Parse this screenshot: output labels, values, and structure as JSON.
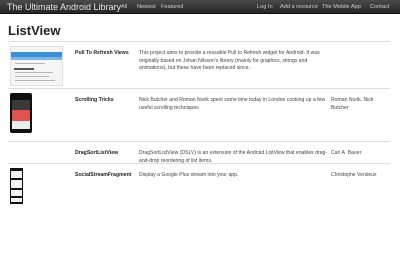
{
  "navbar": {
    "brand": "The Ultimate Android Library",
    "left_links": [
      "All",
      "Newest",
      "Featured"
    ],
    "right_links": [
      "Log In",
      "Add a resource",
      "The Mobile App",
      "Contact"
    ]
  },
  "page": {
    "title": "ListView"
  },
  "rows": [
    {
      "name": "Pull To Refresh Views",
      "description": "This project aims to provide a reusable Pull to Refresh widget for Android. It was originally based on Johan Nilsson's library (mainly for graphics, strings and animations), but these have been replaced since.",
      "author": "",
      "thumbnail": "tablet-screenshot"
    },
    {
      "name": "Scrolling Tricks",
      "description": "Nick Butcher and Roman Nurik spent some time today in London cooking up a few useful scrolling techniques",
      "author": "Roman Nurik, Nick Butcher",
      "thumbnail": "phone-screenshot"
    },
    {
      "name": "DragSortListView",
      "description": "DragSortListView (DSLV) is an extension of the Android ListView that enables drag-and-drop reordering of list items.",
      "author": "Carl A. Bauer",
      "thumbnail": ""
    },
    {
      "name": "SocialStreamFragment",
      "description": "Display a Google Plus stream into your app.",
      "author": "Christophe Versieux",
      "thumbnail": "phone-stream-screenshot"
    }
  ]
}
